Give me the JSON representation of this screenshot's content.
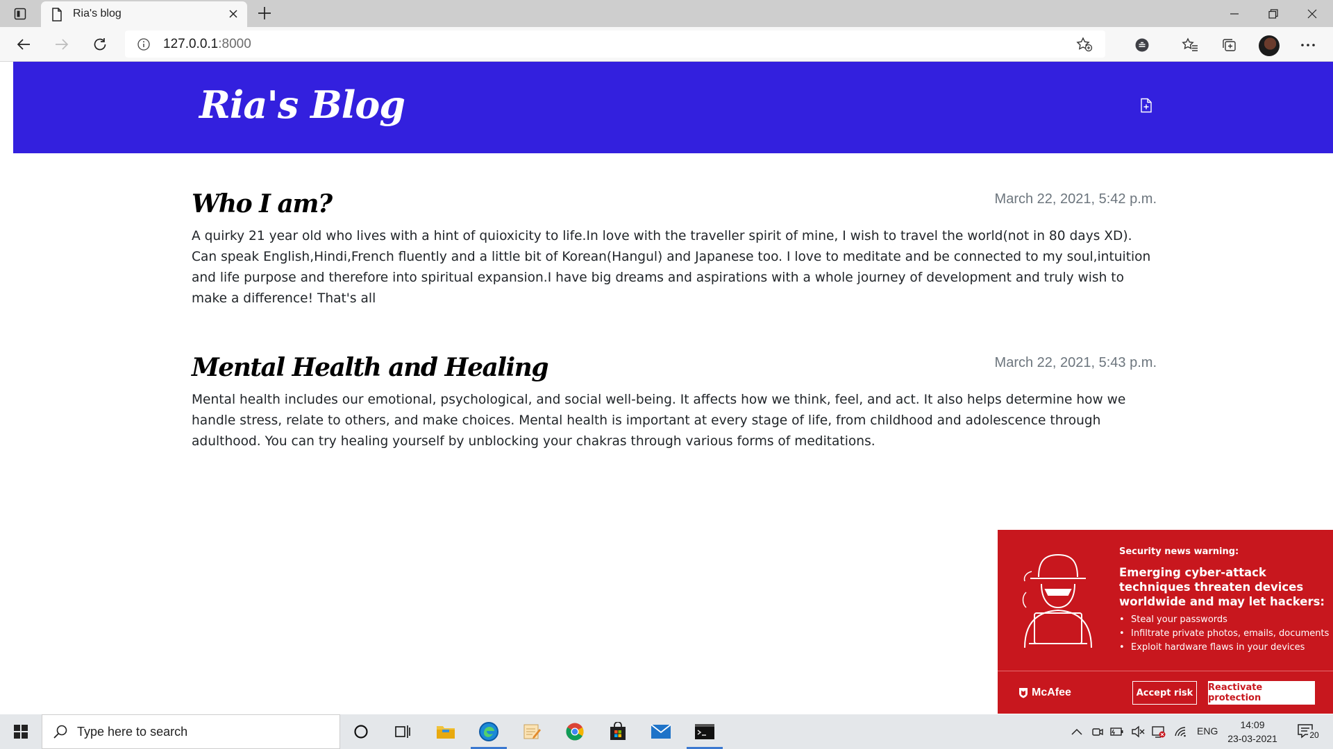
{
  "browser": {
    "tab_title": "Ria's blog",
    "url_host": "127.0.0.1",
    "url_port": ":8000"
  },
  "blog": {
    "brand": "Ria's Blog",
    "posts": [
      {
        "title": "Who I am?",
        "date": "March 22, 2021, 5:42 p.m.",
        "body": "A quirky 21 year old who lives with a hint of quioxicity to life.In love with the traveller spirit of mine, I wish to travel the world(not in 80 days XD). Can speak English,Hindi,French fluently and a little bit of Korean(Hangul) and Japanese too. I love to meditate and be connected to my soul,intuition and life purpose and therefore into spiritual expansion.I have big dreams and aspirations with a whole journey of development and truly wish to make a difference! That's all"
      },
      {
        "title": "Mental Health and Healing",
        "date": "March 22, 2021, 5:43 p.m.",
        "body": "Mental health includes our emotional, psychological, and social well-being. It affects how we think, feel, and act. It also helps determine how we handle stress, relate to others, and make choices. Mental health is important at every stage of life, from childhood and adolescence through adulthood. You can try healing yourself by unblocking your chakras through various forms of meditations."
      }
    ]
  },
  "mcafee": {
    "kicker": "Security news warning:",
    "headline": "Emerging cyber-attack techniques threaten devices worldwide and may let hackers:",
    "bullets": [
      "Steal your passwords",
      "Infiltrate private photos, emails, documents",
      "Exploit hardware flaws in your devices"
    ],
    "brand": "McAfee",
    "accept_label": "Accept risk",
    "reactivate_label": "Reactivate protection"
  },
  "taskbar": {
    "search_placeholder": "Type here to search",
    "language": "ENG",
    "time": "14:09",
    "date": "23-03-2021",
    "notification_count": "20"
  },
  "colors": {
    "blog_header": "#3320de",
    "mcafee_red": "#c8171e"
  },
  "icons": [
    "tab-actions-icon",
    "page-favicon-icon",
    "close-icon",
    "plus-icon",
    "minimize-icon",
    "restore-icon",
    "back-icon",
    "forward-icon",
    "refresh-icon",
    "info-icon",
    "favorite-add-icon",
    "extension-icon",
    "favorites-icon",
    "collections-icon",
    "more-icon",
    "new-post-icon",
    "hacker-icon",
    "mcafee-shield-icon",
    "windows-icon",
    "search-icon",
    "cortana-icon",
    "task-view-icon",
    "file-explorer-icon",
    "edge-icon",
    "notepad-icon",
    "chrome-icon",
    "store-icon",
    "mail-icon",
    "terminal-icon",
    "chevron-up-icon",
    "meet-now-icon",
    "battery-icon",
    "volume-muted-icon",
    "windows-security-icon",
    "wifi-icon",
    "notification-icon"
  ]
}
